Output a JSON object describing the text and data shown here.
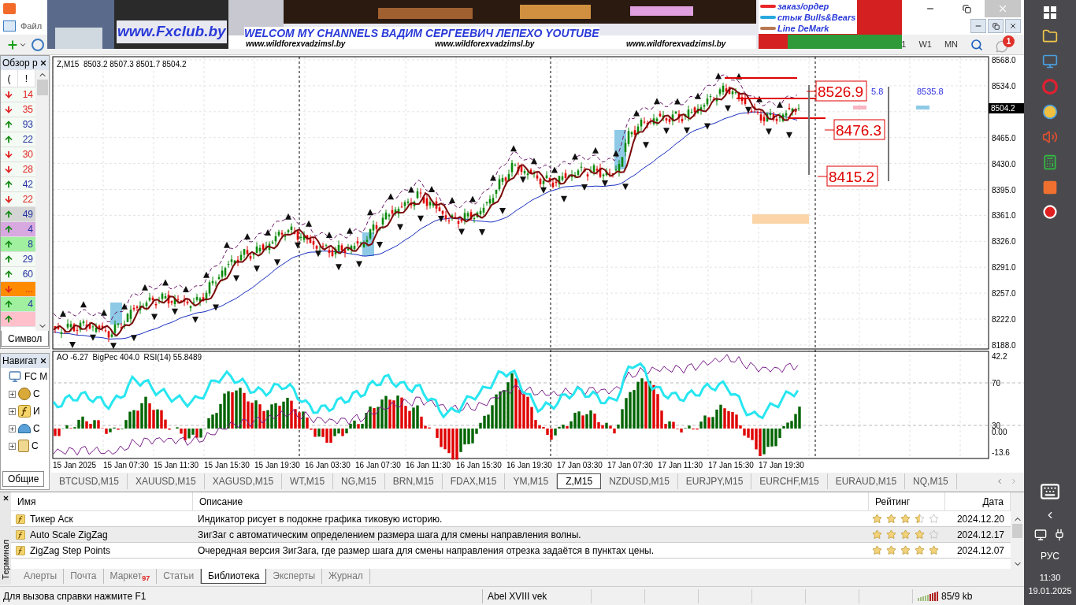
{
  "menu": [
    "Файл"
  ],
  "toolbar": {
    "timeframes": [
      "1",
      "W1",
      "MN"
    ],
    "notifications": "1"
  },
  "banner": {
    "site": "www.Fxclub.by",
    "headline": "WELCOM MY CHANNELS ВАДИМ СЕРГЕЕВИЧ ЛЕПЕХО YOUTUBE",
    "links": [
      "www.wildforexvadzimsl.by",
      "www.wildforexvadzimsl.by",
      "www.wildforexvadzimsl.by"
    ],
    "legend": [
      {
        "label": "заказ/ордер",
        "color": "#e8262a"
      },
      {
        "label": "стык Bulls&Bears",
        "color": "#29a8e0"
      },
      {
        "label": "Line DeMark",
        "color": "#b87850"
      }
    ]
  },
  "market_watch": {
    "title": "Обзор р",
    "columns": [
      "(",
      "!"
    ],
    "tab": "Символ",
    "rows": [
      {
        "up": false,
        "value": "14",
        "color": "#f4faf4"
      },
      {
        "up": false,
        "value": "35",
        "color": "#f4faf4"
      },
      {
        "up": true,
        "value": "93",
        "color": "#f4faf4"
      },
      {
        "up": true,
        "value": "22",
        "color": "#f4faf4"
      },
      {
        "up": false,
        "value": "30",
        "color": "#f4faf4"
      },
      {
        "up": false,
        "value": "28",
        "color": "#f4faf4"
      },
      {
        "up": true,
        "value": "42",
        "color": "#f4faf4"
      },
      {
        "up": false,
        "value": "22",
        "color": "#f4faf4"
      },
      {
        "up": true,
        "value": "49",
        "color": "#d4d4d4"
      },
      {
        "up": true,
        "value": "4",
        "color": "#d8a8e0"
      },
      {
        "up": true,
        "value": "8",
        "color": "#a0f0a0"
      },
      {
        "up": true,
        "value": "29",
        "color": "#f4faf4"
      },
      {
        "up": true,
        "value": "60",
        "color": "#f4faf4"
      },
      {
        "up": false,
        "value": "...",
        "color": "#ff8c00"
      },
      {
        "up": true,
        "value": "4",
        "color": "#a0f0a0"
      },
      {
        "up": true,
        "color": "#ffc0cb"
      }
    ]
  },
  "navigator": {
    "title": "Навигат",
    "tab": "Общие",
    "tree": {
      "label": "FC M",
      "children": [
        {
          "label": "С",
          "kind": "accounts"
        },
        {
          "label": "И",
          "kind": "indicators"
        },
        {
          "label": "С",
          "kind": "experts"
        },
        {
          "label": "С",
          "kind": "scripts"
        }
      ]
    }
  },
  "chart": {
    "header": "Z,M15  8503.2 8507.3 8501.7 8504.2",
    "current_price": "8504.2",
    "price_axis": [
      "8568.0",
      "8534.0",
      "8465.0",
      "8430.0",
      "8395.0",
      "8361.0",
      "8326.0",
      "8291.0",
      "8257.0",
      "8222.0",
      "8188.0"
    ],
    "levels": [
      "8526.9",
      "8476.3",
      "8415.2"
    ],
    "notes": [
      "5.8",
      "8535.8"
    ],
    "subwindow": {
      "header": "AO -6.27  BigPec 404.0  RSI(14) 55.8489",
      "axis": [
        "42.2",
        "70",
        "30",
        "0.00",
        "-13.6"
      ]
    },
    "time_axis": [
      "15 Jan 2025",
      "15 Jan 07:30",
      "15 Jan 11:30",
      "15 Jan 15:30",
      "15 Jan 19:30",
      "16 Jan 03:30",
      "16 Jan 07:30",
      "16 Jan 11:30",
      "16 Jan 15:30",
      "16 Jan 19:30",
      "17 Jan 03:30",
      "17 Jan 07:30",
      "17 Jan 11:30",
      "17 Jan 15:30",
      "17 Jan 19:30"
    ]
  },
  "chart_tabs": [
    {
      "label": "BTCUSD,M15",
      "selected": false
    },
    {
      "label": "XAUUSD,M15",
      "selected": false
    },
    {
      "label": "XAGUSD,M15",
      "selected": false
    },
    {
      "label": "WT,M15",
      "selected": false
    },
    {
      "label": "NG,M15",
      "selected": false
    },
    {
      "label": "BRN,M15",
      "selected": false
    },
    {
      "label": "FDAX,M15",
      "selected": false
    },
    {
      "label": "YM,M15",
      "selected": false
    },
    {
      "label": "Z,M15",
      "selected": true
    },
    {
      "label": "NZDUSD,M15",
      "selected": false
    },
    {
      "label": "EURJPY,M15",
      "selected": false
    },
    {
      "label": "EURCHF,M15",
      "selected": false
    },
    {
      "label": "EURAUD,M15",
      "selected": false
    },
    {
      "label": "NQ,M15",
      "selected": false
    }
  ],
  "terminal": {
    "label": "Терминал",
    "columns": [
      "Имя",
      "Описание",
      "Рейтинг",
      "Дата"
    ],
    "rows": [
      {
        "name": "Тикер Аск",
        "description": "Индикатор рисует в подокне графика тиковую историю.",
        "stars": 3.5,
        "date": "2024.12.20"
      },
      {
        "name": "Auto Scale ZigZag",
        "description": "ЗигЗаг с автоматическим определением размера шага для смены направления волны.",
        "stars": 4,
        "date": "2024.12.17"
      },
      {
        "name": "ZigZag Step Points",
        "description": "Очередная версия ЗигЗага, где размер шага для смены направления отрезка задаётся в пунктах цены.",
        "stars": 5,
        "date": "2024.12.07"
      }
    ],
    "tabs": [
      {
        "label": "Алерты",
        "selected": false
      },
      {
        "label": "Почта",
        "selected": false
      },
      {
        "label": "Маркет",
        "badge": "97",
        "selected": false
      },
      {
        "label": "Статьи",
        "selected": false
      },
      {
        "label": "Библиотека",
        "selected": true
      },
      {
        "label": "Эксперты",
        "selected": false
      },
      {
        "label": "Журнал",
        "selected": false
      }
    ]
  },
  "status_bar": {
    "help": "Для вызова справки нажмите F1",
    "profile": "Abel XVIII vek",
    "traffic": "85/9 kb"
  },
  "taskbar": {
    "language": "РУС",
    "time": "11:30",
    "date": "19.01.2025"
  }
}
